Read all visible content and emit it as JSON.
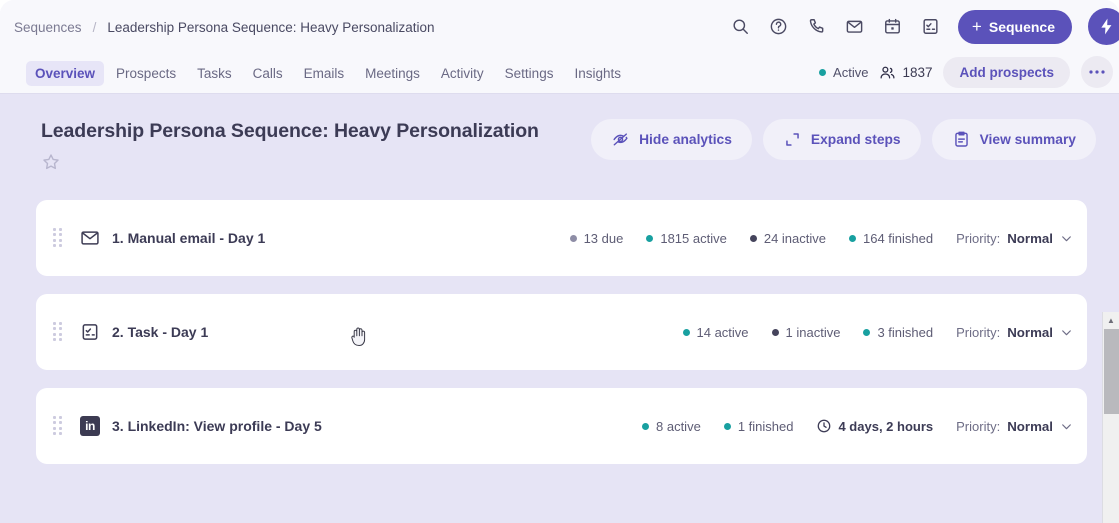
{
  "breadcrumb": {
    "root": "Sequences",
    "separator": "/",
    "current": "Leadership Persona Sequence: Heavy Personalization"
  },
  "topbar": {
    "icons": [
      {
        "name": "search-icon",
        "label": "Search"
      },
      {
        "name": "help-icon",
        "label": "Help"
      },
      {
        "name": "phone-icon",
        "label": "Call"
      },
      {
        "name": "mail-icon",
        "label": "Email"
      },
      {
        "name": "calendar-icon",
        "label": "Calendar"
      },
      {
        "name": "task-icon",
        "label": "Tasks"
      }
    ],
    "sequence_button": "Sequence",
    "sequence_plus": "+",
    "bolt_icon": "bolt-icon"
  },
  "tabs": [
    {
      "label": "Overview",
      "active": true
    },
    {
      "label": "Prospects",
      "active": false
    },
    {
      "label": "Tasks",
      "active": false
    },
    {
      "label": "Calls",
      "active": false
    },
    {
      "label": "Emails",
      "active": false
    },
    {
      "label": "Meetings",
      "active": false
    },
    {
      "label": "Activity",
      "active": false
    },
    {
      "label": "Settings",
      "active": false
    },
    {
      "label": "Insights",
      "active": false
    }
  ],
  "status": {
    "label": "Active",
    "dot_color": "#18a0a0",
    "prospect_count": "1837",
    "add_prospects_label": "Add prospects",
    "overflow_label": "•••"
  },
  "page": {
    "title": "Leadership Persona Sequence: Heavy Personalization",
    "favorite_icon": "star-icon",
    "actions": [
      {
        "label": "Hide analytics",
        "icon": "eye-off-icon"
      },
      {
        "label": "Expand steps",
        "icon": "expand-icon"
      },
      {
        "label": "View summary",
        "icon": "clipboard-icon"
      }
    ]
  },
  "colors": {
    "brand_purple": "#5b52ba",
    "page_bg": "#e6e4f5",
    "teal": "#18a0a0",
    "gray_dot": "#8e8da6",
    "dark_dot": "#45445c"
  },
  "steps": [
    {
      "handle": "drag-handle",
      "icon": "mail-icon",
      "label": "1. Manual email - Day 1",
      "stats": [
        {
          "value": "13 due",
          "color": "#8e8da6"
        },
        {
          "value": "1815 active",
          "color": "#18a0a0"
        },
        {
          "value": "24 inactive",
          "color": "#45445c"
        },
        {
          "value": "164 finished",
          "color": "#18a0a0"
        }
      ],
      "duration": null,
      "priority_label": "Priority:",
      "priority_value": "Normal"
    },
    {
      "handle": "drag-handle",
      "icon": "task-icon",
      "label": "2. Task - Day 1",
      "stats": [
        {
          "value": "14 active",
          "color": "#18a0a0"
        },
        {
          "value": "1 inactive",
          "color": "#45445c"
        },
        {
          "value": "3 finished",
          "color": "#18a0a0"
        }
      ],
      "duration": null,
      "priority_label": "Priority:",
      "priority_value": "Normal"
    },
    {
      "handle": "drag-handle",
      "icon": "linkedin-icon",
      "icon_text": "in",
      "label": "3. LinkedIn: View profile - Day 5",
      "stats": [
        {
          "value": "8 active",
          "color": "#18a0a0"
        },
        {
          "value": "1 finished",
          "color": "#18a0a0"
        }
      ],
      "duration": "4 days, 2 hours",
      "priority_label": "Priority:",
      "priority_value": "Normal"
    }
  ],
  "scrollbar": {
    "up_arrow": "▲"
  },
  "cursor": {
    "type": "grab-hand-cursor"
  }
}
